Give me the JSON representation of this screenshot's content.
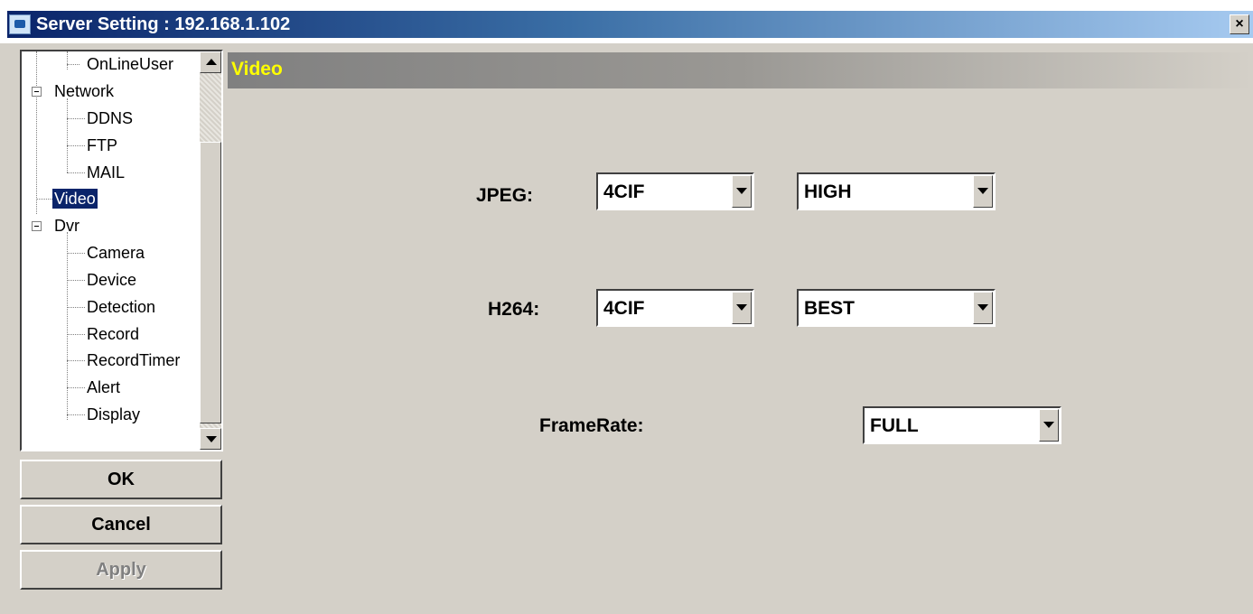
{
  "window": {
    "title": "Server Setting : 192.168.1.102",
    "close_label": "×"
  },
  "tree": {
    "items": [
      {
        "label": "OnLineUser",
        "selected": false
      },
      {
        "label": "Network",
        "selected": false
      },
      {
        "label": "DDNS",
        "selected": false
      },
      {
        "label": "FTP",
        "selected": false
      },
      {
        "label": "MAIL",
        "selected": false
      },
      {
        "label": "Video",
        "selected": true
      },
      {
        "label": "Dvr",
        "selected": false
      },
      {
        "label": "Camera",
        "selected": false
      },
      {
        "label": "Device",
        "selected": false
      },
      {
        "label": "Detection",
        "selected": false
      },
      {
        "label": "Record",
        "selected": false
      },
      {
        "label": "RecordTimer",
        "selected": false
      },
      {
        "label": "Alert",
        "selected": false
      },
      {
        "label": "Display",
        "selected": false
      }
    ]
  },
  "buttons": {
    "ok": "OK",
    "cancel": "Cancel",
    "apply": "Apply"
  },
  "panel": {
    "header": "Video",
    "colors": {
      "header_text": "#ffff00",
      "selection": "#0a246a"
    }
  },
  "form": {
    "jpeg": {
      "label": "JPEG:",
      "resolution": "4CIF",
      "quality": "HIGH"
    },
    "h264": {
      "label": "H264:",
      "resolution": "4CIF",
      "quality": "BEST"
    },
    "framerate": {
      "label": "FrameRate:",
      "value": "FULL"
    }
  }
}
